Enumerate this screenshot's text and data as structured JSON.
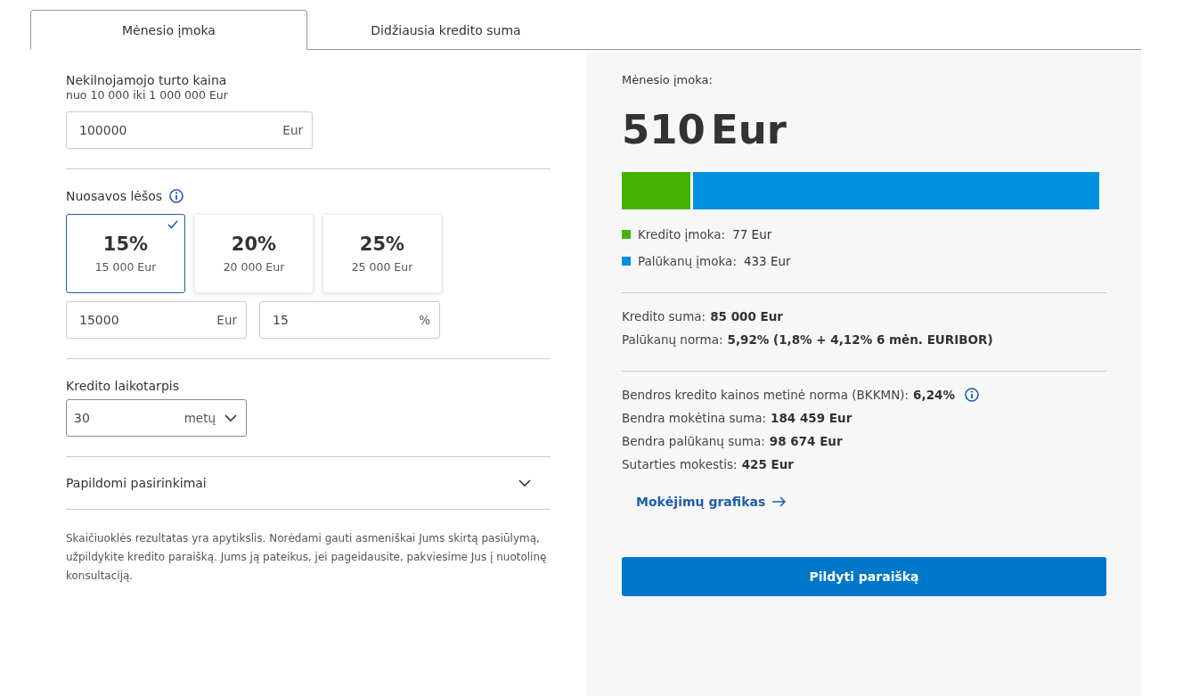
{
  "tabs": [
    {
      "label": "Mėnesio įmoka",
      "selected": true
    },
    {
      "label": "Didžiausia kredito suma",
      "selected": false
    }
  ],
  "form": {
    "price": {
      "label": "Nekilnojamojo turto kaina",
      "hint": "nuo 10 000 iki 1 000 000 Eur",
      "value": "100000",
      "unit": "Eur"
    },
    "own_funds": {
      "label": "Nuosavos lėšos",
      "info": true,
      "options": [
        {
          "percent": "15%",
          "amount": "15 000 Eur",
          "selected": true
        },
        {
          "percent": "20%",
          "amount": "20 000 Eur",
          "selected": false
        },
        {
          "percent": "25%",
          "amount": "25 000 Eur",
          "selected": false
        }
      ],
      "fields": [
        {
          "value": "15000",
          "unit": "Eur"
        },
        {
          "value": "15",
          "unit": "%"
        }
      ]
    },
    "term": {
      "label": "Kredito laikotarpis",
      "value": "30",
      "unit": "metų"
    },
    "extra": {
      "label": "Papildomi pasirinkimai",
      "expanded": false
    },
    "disclaimer": "Skaičiuoklės rezultatas yra apytikslis. Norėdami gauti asmeniškai Jums skirtą pasiūlymą, užpildykite kredito paraišką. Jums ją pateikus, jei pageidausite, pakviesime Jus į nuotolinę konsultaciją."
  },
  "result": {
    "title": "Mėnesio įmoka:",
    "amount": "510",
    "unit": "Eur",
    "payment_bar": {
      "level": 0.15
    },
    "legend": [
      {
        "label": "Kredito įmoka:",
        "value": "77 Eur",
        "color": "#44b200"
      },
      {
        "label": "Palūkanų įmoka:",
        "value": "433 Eur",
        "color": "#0090df"
      }
    ],
    "details": [
      {
        "label": "Kredito suma:",
        "value": "85 000 Eur",
        "info": false
      },
      {
        "label": "Palūkanų norma:",
        "value": "5,92% (1,8% + 4,12% 6 mėn. EURIBOR)",
        "info": false
      }
    ],
    "totals": [
      {
        "label": "Bendros kredito kainos metinė norma (BKKMN):",
        "value": "6,24%",
        "info": true
      },
      {
        "label": "Bendra mokėtina suma:",
        "value": "184 459 Eur",
        "info": false
      },
      {
        "label": "Bendra palūkanų suma:",
        "value": "98 674 Eur",
        "info": false
      },
      {
        "label": "Sutarties mokestis:",
        "value": "425 Eur",
        "info": false
      }
    ],
    "link": "Mokėjimų grafikas",
    "button": "Pildyti paraišką"
  }
}
